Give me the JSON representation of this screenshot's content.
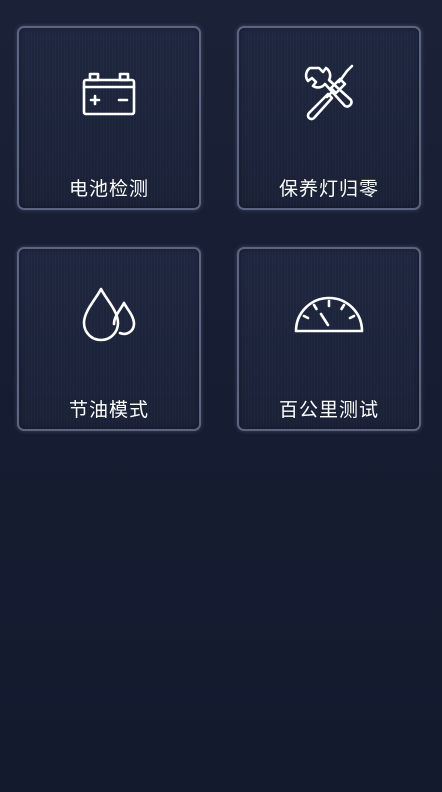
{
  "tiles": [
    {
      "label": "电池检测",
      "icon": "battery-icon"
    },
    {
      "label": "保养灯归零",
      "icon": "wrench-screwdriver-icon"
    },
    {
      "label": "节油模式",
      "icon": "oil-drops-icon"
    },
    {
      "label": "百公里测试",
      "icon": "speedometer-icon"
    }
  ],
  "colors": {
    "background": "#161c31",
    "tile_border": "#5b6480",
    "text": "#ffffff"
  }
}
